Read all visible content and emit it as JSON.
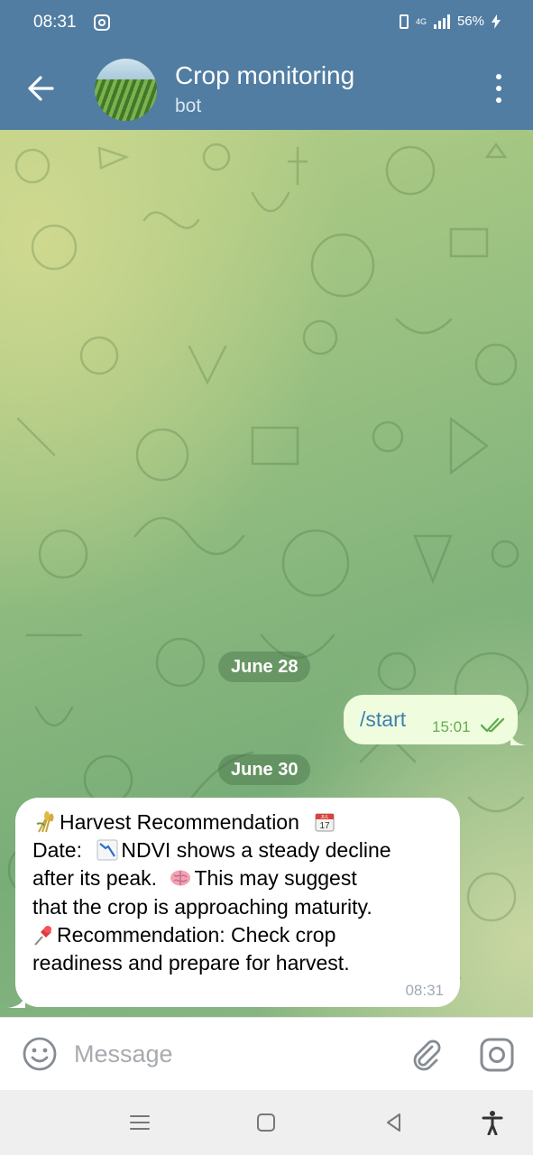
{
  "status_bar": {
    "time": "08:31",
    "network": "4G",
    "battery": "56%"
  },
  "header": {
    "title": "Crop monitoring",
    "subtitle": "bot"
  },
  "chat": {
    "date_1": "June 28",
    "sent_message": {
      "text": "/start",
      "time": "15:01"
    },
    "date_2": "June 30",
    "received_message": {
      "line_1": "Harvest Recommendation",
      "line_2_prefix": "Date:",
      "line_2_rest": "NDVI shows a steady decline",
      "line_3_a": "after its peak.",
      "line_3_b": "This may suggest",
      "line_4": "that the crop is approaching maturity.",
      "line_5": "Recommendation: Check crop",
      "line_6": "readiness and prepare for harvest.",
      "time": "08:31",
      "icons": [
        "sheaf-of-rice-icon",
        "calendar-icon",
        "chart-decreasing-icon",
        "brain-icon",
        "pushpin-icon"
      ],
      "calendar_icon_text": {
        "month": "JUL",
        "day": "17"
      }
    }
  },
  "input": {
    "placeholder": "Message"
  },
  "colors": {
    "header": "#517da2",
    "outgoing_bubble": "#effdde",
    "incoming_bubble": "#ffffff",
    "check": "#62ad54"
  }
}
